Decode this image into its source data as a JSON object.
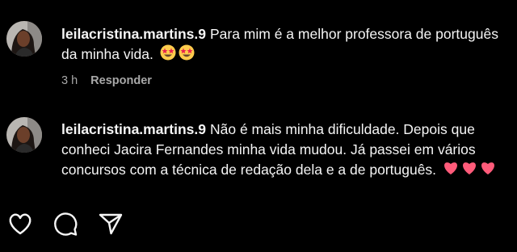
{
  "comments": [
    {
      "username": "leilacristina.martins.9",
      "text": "Para mim é a melhor professora de português da minha vida.",
      "emojis": [
        "star-struck-emoji",
        "star-struck-emoji"
      ],
      "time": "3 h",
      "reply_label": "Responder"
    },
    {
      "username": "leilacristina.martins.9",
      "text": "Não é mais minha dificuldade. Depois que conheci Jacira Fernandes minha vida mudou. Já passei em vários concursos com a técnica de redação dela e a de português.",
      "emojis": [
        "heart-emoji",
        "heart-emoji",
        "heart-emoji"
      ]
    }
  ],
  "actions": [
    "heart-icon",
    "comment-icon",
    "share-icon"
  ],
  "colors": {
    "background": "#000000",
    "text": "#f5f5f5",
    "meta": "#a8a8a8",
    "heart_emoji": "#ff5b7a",
    "star_struck_face": "#ffcc4d"
  }
}
